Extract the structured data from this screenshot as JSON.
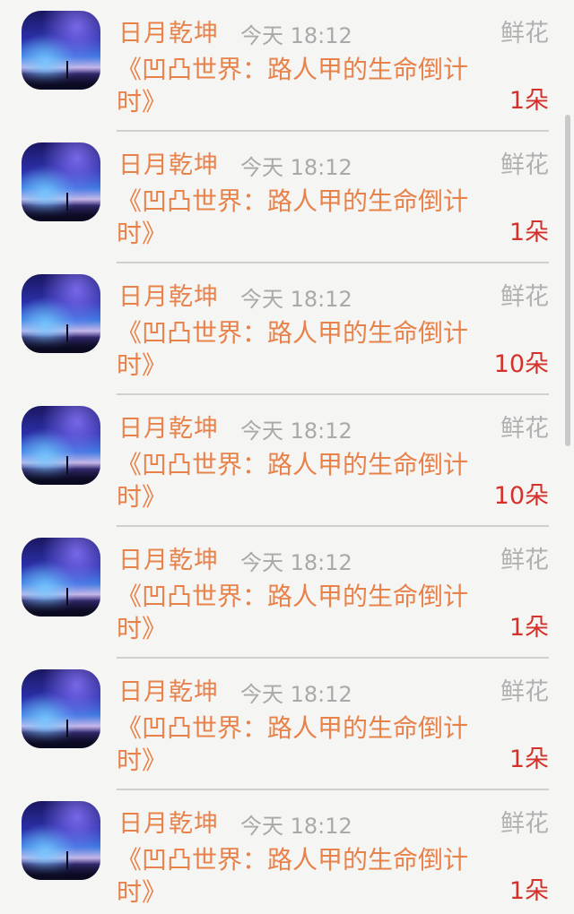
{
  "items": [
    {
      "name": "日月乾坤",
      "time": "今天 18:12",
      "gift": "鲜花",
      "message": "《凹凸世界：路人甲的生命倒计时》",
      "count": "1朵"
    },
    {
      "name": "日月乾坤",
      "time": "今天 18:12",
      "gift": "鲜花",
      "message": "《凹凸世界：路人甲的生命倒计时》",
      "count": "1朵"
    },
    {
      "name": "日月乾坤",
      "time": "今天 18:12",
      "gift": "鲜花",
      "message": "《凹凸世界：路人甲的生命倒计时》",
      "count": "10朵"
    },
    {
      "name": "日月乾坤",
      "time": "今天 18:12",
      "gift": "鲜花",
      "message": "《凹凸世界：路人甲的生命倒计时》",
      "count": "10朵"
    },
    {
      "name": "日月乾坤",
      "time": "今天 18:12",
      "gift": "鲜花",
      "message": "《凹凸世界：路人甲的生命倒计时》",
      "count": "1朵"
    },
    {
      "name": "日月乾坤",
      "time": "今天 18:12",
      "gift": "鲜花",
      "message": "《凹凸世界：路人甲的生命倒计时》",
      "count": "1朵"
    },
    {
      "name": "日月乾坤",
      "time": "今天 18:12",
      "gift": "鲜花",
      "message": "《凹凸世界：路人甲的生命倒计时》",
      "count": "1朵"
    }
  ]
}
